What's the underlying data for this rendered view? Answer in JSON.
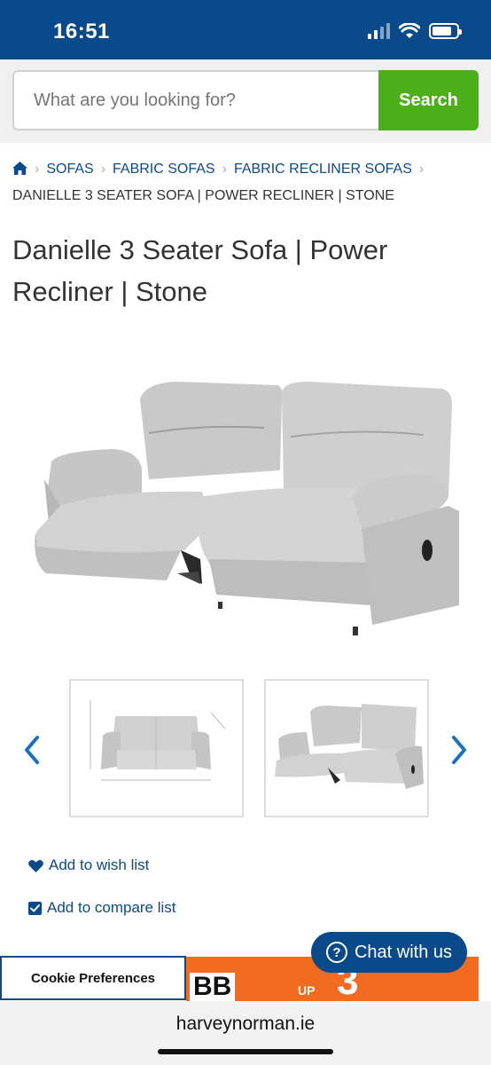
{
  "status_bar": {
    "time": "16:51"
  },
  "search": {
    "placeholder": "What are you looking for?",
    "button_label": "Search"
  },
  "breadcrumb": {
    "items": [
      "SOFAS",
      "FABRIC SOFAS",
      "FABRIC RECLINER SOFAS"
    ],
    "current": "DANIELLE 3 SEATER SOFA | POWER RECLINER | STONE"
  },
  "product": {
    "title": "Danielle 3 Seater Sofa | Power Recliner | Stone"
  },
  "actions": {
    "wish_list": "Add to wish list",
    "compare_list": "Add to compare list"
  },
  "chat": {
    "label": "Chat with us"
  },
  "cookie": {
    "label": "Cookie Preferences"
  },
  "promo": {
    "left_text": "BB",
    "up_text": "UP",
    "number": "3"
  },
  "browser": {
    "url": "harveynorman.ie"
  },
  "colors": {
    "brand_blue": "#0a4a8a",
    "search_green": "#4caf1a",
    "promo_orange": "#f36a21"
  }
}
